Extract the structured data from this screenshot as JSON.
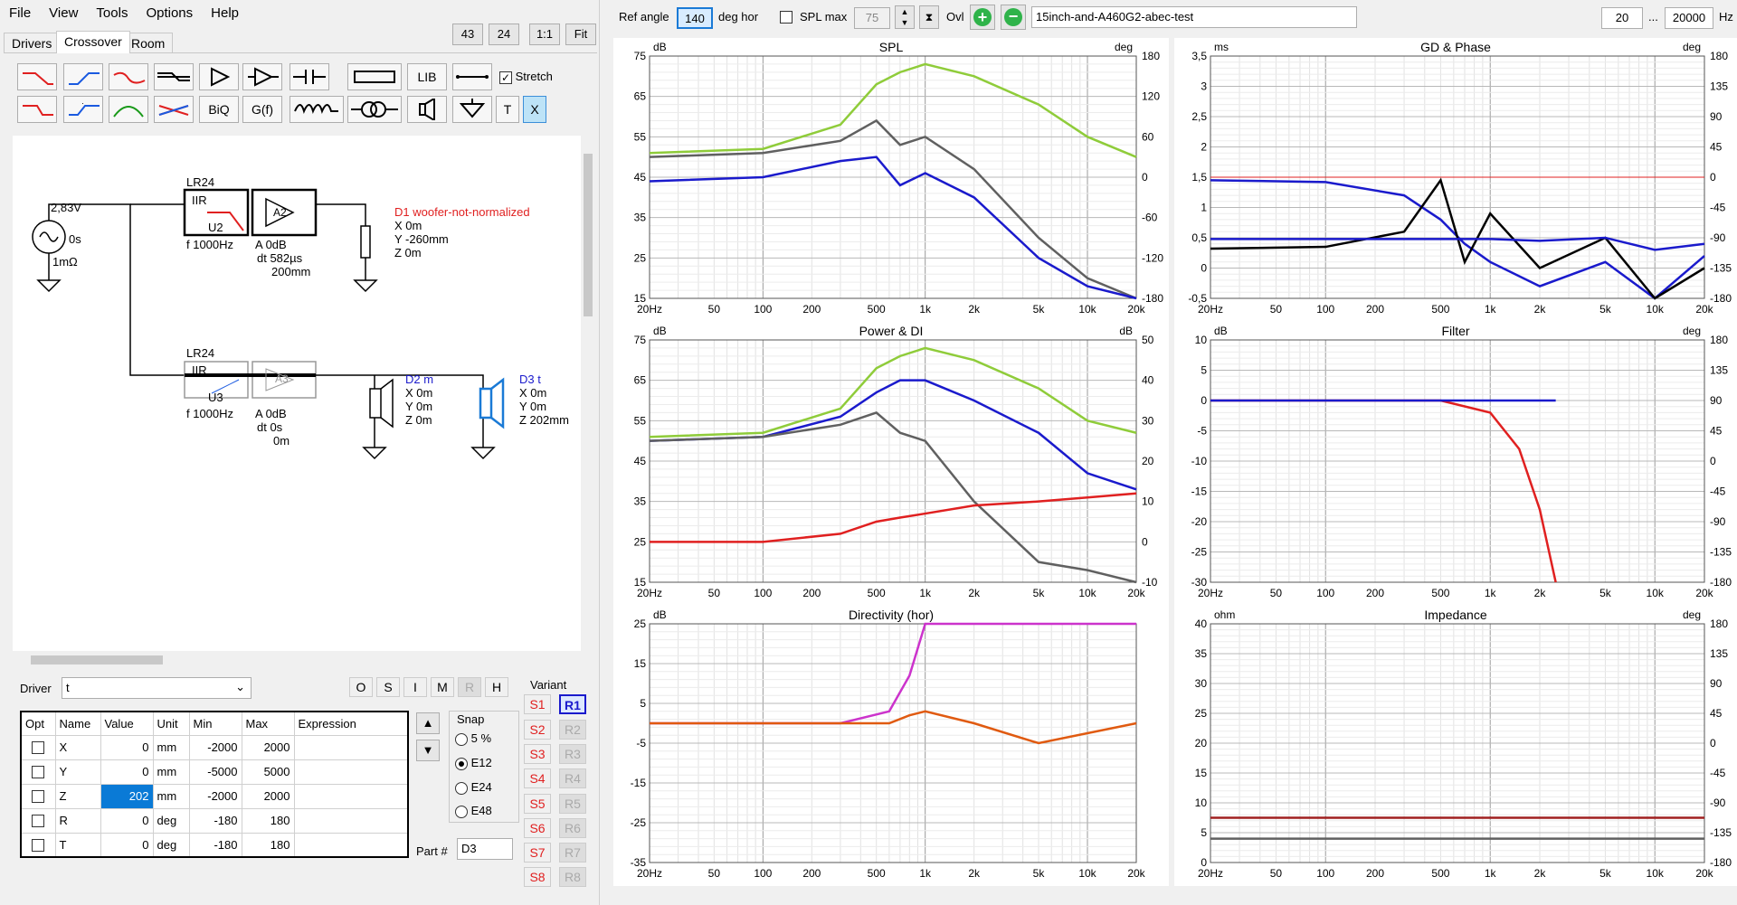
{
  "menu": [
    "File",
    "View",
    "Tools",
    "Options",
    "Help"
  ],
  "toolbar": {
    "num1": "43",
    "num2": "24",
    "ratio": "1:1",
    "fit": "Fit"
  },
  "tabs": [
    "Drivers",
    "Crossover",
    "Room"
  ],
  "tools": {
    "lib": "LIB",
    "biq": "BiQ",
    "gf": "G(f)",
    "t": "T",
    "x": "X",
    "stretch": "Stretch"
  },
  "schematic": {
    "src_v": "2,83V",
    "src_t": "0s",
    "src_r": "1mΩ",
    "f1": {
      "type": "LR24",
      "iir": "IIR",
      "u": "U2",
      "f": "f   1000Hz"
    },
    "a1": {
      "name": "A2",
      "a": "A  0dB",
      "dt": "dt  582µs",
      "d": "200mm"
    },
    "d1": {
      "name": "D1 woofer-not-normalized",
      "x": "X  0m",
      "y": "Y  -260mm",
      "z": "Z  0m"
    },
    "f2": {
      "type": "LR24",
      "iir": "IIR",
      "u": "U3",
      "f": "f   1000Hz"
    },
    "a2": {
      "name": "A3",
      "a": "A  0dB",
      "dt": "dt  0s",
      "d": "0m"
    },
    "d2": {
      "name": "D2 m",
      "x": "X  0m",
      "y": "Y  0m",
      "z": "Z  0m"
    },
    "d3": {
      "name": "D3 t",
      "x": "X  0m",
      "y": "Y  0m",
      "z": "Z  202mm"
    }
  },
  "driver": {
    "label": "Driver",
    "value": "t"
  },
  "modebtns": [
    "O",
    "S",
    "I",
    "M",
    "R",
    "H"
  ],
  "table": {
    "headers": [
      "Opt",
      "Name",
      "Value",
      "Unit",
      "Min",
      "Max",
      "Expression"
    ],
    "rows": [
      {
        "name": "X",
        "value": "0",
        "unit": "mm",
        "min": "-2000",
        "max": "2000"
      },
      {
        "name": "Y",
        "value": "0",
        "unit": "mm",
        "min": "-5000",
        "max": "5000"
      },
      {
        "name": "Z",
        "value": "202",
        "unit": "mm",
        "min": "-2000",
        "max": "2000"
      },
      {
        "name": "R",
        "value": "0",
        "unit": "deg",
        "min": "-180",
        "max": "180"
      },
      {
        "name": "T",
        "value": "0",
        "unit": "deg",
        "min": "-180",
        "max": "180"
      }
    ]
  },
  "snap": {
    "label": "Snap",
    "options": [
      "5 %",
      "E12",
      "E24",
      "E48"
    ],
    "selected": "E12"
  },
  "part": {
    "label": "Part #",
    "value": "D3"
  },
  "variant": {
    "label": "Variant",
    "s": [
      "S1",
      "S2",
      "S3",
      "S4",
      "S5",
      "S6",
      "S7",
      "S8"
    ],
    "r": [
      "R1",
      "R2",
      "R3",
      "R4",
      "R5",
      "R6",
      "R7",
      "R8"
    ]
  },
  "topbar": {
    "ref_angle": "Ref angle",
    "angle": "140",
    "deg_hor": "deg hor",
    "splmax": "SPL max",
    "splval": "75",
    "ovl": "Ovl",
    "project": "15inch-and-A460G2-abec-test",
    "fmin": "20",
    "dots": "...",
    "fmax": "20000",
    "hz": "Hz"
  },
  "colors": {
    "green": "#8fcc3a",
    "gray": "#606060",
    "blue": "#1a1acc",
    "red": "#e02020",
    "purple": "#cc33cc",
    "accent": "#0a7ad6"
  },
  "xticks": [
    "20Hz",
    "50",
    "100",
    "200",
    "500",
    "1k",
    "2k",
    "5k",
    "10k",
    "20k"
  ],
  "plots": [
    {
      "id": "spl",
      "title": "SPL",
      "lu": "dB",
      "ru": "deg",
      "left": [
        "75",
        "65",
        "55",
        "45",
        "35",
        "25",
        "15"
      ],
      "right": [
        "180",
        "120",
        "60",
        "0",
        "-60",
        "-120",
        "-180"
      ]
    },
    {
      "id": "gd",
      "title": "GD & Phase",
      "lu": "ms",
      "ru": "deg",
      "left": [
        "3,5",
        "3",
        "2,5",
        "2",
        "1,5",
        "1",
        "0,5",
        "0",
        "-0,5"
      ],
      "right": [
        "180",
        "135",
        "90",
        "45",
        "0",
        "-45",
        "-90",
        "-135",
        "-180"
      ]
    },
    {
      "id": "pdi",
      "title": "Power & DI",
      "lu": "dB",
      "ru": "dB",
      "left": [
        "75",
        "65",
        "55",
        "45",
        "35",
        "25",
        "15"
      ],
      "right": [
        "50",
        "40",
        "30",
        "20",
        "10",
        "0",
        "-10"
      ]
    },
    {
      "id": "filter",
      "title": "Filter",
      "lu": "dB",
      "ru": "deg",
      "left": [
        "10",
        "5",
        "0",
        "-5",
        "-10",
        "-15",
        "-20",
        "-25",
        "-30"
      ],
      "right": [
        "180",
        "135",
        "90",
        "45",
        "0",
        "-45",
        "-90",
        "-135",
        "-180"
      ]
    },
    {
      "id": "dir",
      "title": "Directivity (hor)",
      "lu": "dB",
      "ru": "",
      "left": [
        "25",
        "15",
        "5",
        "-5",
        "-15",
        "-25",
        "-35"
      ],
      "right": []
    },
    {
      "id": "imp",
      "title": "Impedance",
      "lu": "ohm",
      "ru": "deg",
      "left": [
        "40",
        "35",
        "30",
        "25",
        "20",
        "15",
        "10",
        "5",
        "0"
      ],
      "right": [
        "180",
        "135",
        "90",
        "45",
        "0",
        "-45",
        "-90",
        "-135",
        "-180"
      ]
    }
  ],
  "chart_data": [
    {
      "type": "line",
      "title": "SPL",
      "xlabel": "",
      "ylabel": "dB",
      "ylim": [
        15,
        75
      ],
      "x": [
        20,
        100,
        300,
        500,
        700,
        1000,
        2000,
        5000,
        10000,
        20000
      ],
      "series": [
        {
          "values": [
            51,
            52,
            58,
            68,
            71,
            73,
            70,
            63,
            55,
            50
          ]
        },
        {
          "values": [
            50,
            51,
            54,
            59,
            53,
            55,
            47,
            30,
            20,
            15
          ]
        },
        {
          "values": [
            44,
            45,
            49,
            50,
            43,
            46,
            40,
            25,
            18,
            15
          ]
        }
      ]
    },
    {
      "type": "line",
      "title": "GD & Phase",
      "ylabel": "ms",
      "ylim": [
        -0.5,
        3.5
      ],
      "x": [
        20,
        100,
        300,
        500,
        700,
        1000,
        2000,
        5000,
        10000,
        20000
      ],
      "series": [
        {
          "values": [
            1.45,
            1.42,
            1.2,
            0.8,
            0.4,
            0.1,
            -0.3,
            0.1,
            -0.5,
            0.2
          ]
        },
        {
          "values": [
            0.32,
            0.35,
            0.6,
            1.45,
            0.1,
            0.9,
            0,
            0.5,
            -0.5,
            0
          ]
        },
        {
          "values": [
            0.48,
            0.48,
            0.48,
            0.48,
            0.48,
            0.48,
            0.45,
            0.5,
            0.3,
            0.4
          ]
        }
      ]
    },
    {
      "type": "line",
      "title": "Power & DI",
      "ylabel": "dB",
      "ylim": [
        15,
        75
      ],
      "x": [
        20,
        100,
        300,
        500,
        700,
        1000,
        2000,
        5000,
        10000,
        20000
      ],
      "series": [
        {
          "values": [
            51,
            52,
            58,
            68,
            71,
            73,
            70,
            63,
            55,
            52
          ]
        },
        {
          "values": [
            50,
            51,
            56,
            62,
            65,
            65,
            60,
            52,
            42,
            38
          ]
        },
        {
          "values": [
            50,
            51,
            54,
            57,
            52,
            50,
            35,
            20,
            18,
            15
          ]
        },
        {
          "values": [
            25,
            25,
            27,
            30,
            31,
            32,
            34,
            35,
            36,
            37
          ]
        }
      ]
    },
    {
      "type": "line",
      "title": "Filter",
      "ylabel": "dB",
      "ylim": [
        -30,
        10
      ],
      "x": [
        20,
        200,
        500,
        1000,
        1500,
        2000,
        2500
      ],
      "series": [
        {
          "values": [
            0,
            0,
            0,
            -2,
            -8,
            -18,
            -30
          ]
        },
        {
          "values": [
            0,
            0,
            0,
            0,
            0,
            0,
            0
          ]
        }
      ]
    },
    {
      "type": "line",
      "title": "Directivity (hor)",
      "ylabel": "dB",
      "ylim": [
        -35,
        25
      ],
      "x": [
        20,
        300,
        600,
        800,
        1000,
        2000,
        5000,
        20000
      ],
      "series": [
        {
          "values": [
            0,
            0,
            3,
            12,
            25,
            25,
            25,
            25
          ]
        },
        {
          "values": [
            0,
            0,
            0,
            2,
            3,
            0,
            -5,
            0
          ]
        }
      ]
    },
    {
      "type": "line",
      "title": "Impedance",
      "ylabel": "ohm",
      "ylim": [
        0,
        40
      ],
      "x": [
        20,
        20000
      ],
      "series": [
        {
          "values": [
            7.5,
            7.5
          ]
        },
        {
          "values": [
            4,
            4
          ]
        }
      ]
    }
  ]
}
